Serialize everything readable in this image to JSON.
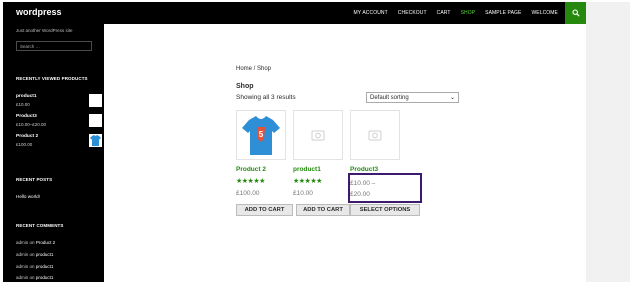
{
  "header": {
    "site_title": "wordpress",
    "nav": [
      "MY ACCOUNT",
      "CHECKOUT",
      "CART",
      "SHOP",
      "SAMPLE PAGE",
      "WELCOME"
    ],
    "active_nav": "SHOP",
    "search_icon": "search-icon",
    "accent_color": "#24890d"
  },
  "sidebar": {
    "tagline": "Just another WordPress site",
    "search_placeholder": "Search …",
    "recently_viewed_title": "RECENTLY VIEWED PRODUCTS",
    "recently_viewed": [
      {
        "name": "product1",
        "price": "£10.00"
      },
      {
        "name": "Product3",
        "price": "£10.00–£20.00"
      },
      {
        "name": "Product 2",
        "price": "£100.00"
      }
    ],
    "recent_posts_title": "RECENT POSTS",
    "recent_posts": [
      "Hello world!"
    ],
    "recent_comments_title": "RECENT COMMENTS",
    "recent_comments": [
      {
        "author": "admin",
        "on": "on",
        "post": "Product 2"
      },
      {
        "author": "admin",
        "on": "on",
        "post": "product1"
      },
      {
        "author": "admin",
        "on": "on",
        "post": "product1"
      },
      {
        "author": "admin",
        "on": "on",
        "post": "product1"
      }
    ]
  },
  "main": {
    "breadcrumb": "Home / Shop",
    "page_title": "Shop",
    "result_count": "Showing all 3 results",
    "sort_selected": "Default sorting",
    "products": [
      {
        "name": "Product 2",
        "rating": 5,
        "stars": "★★★★★",
        "price": "£100.00",
        "button": "ADD TO CART"
      },
      {
        "name": "product1",
        "rating": 5,
        "stars": "★★★★★",
        "price": "£10.00",
        "button": "ADD TO CART"
      },
      {
        "name": "Product3",
        "price_low": "£10.00 –",
        "price_high": "£20.00",
        "button": "SELECT OPTIONS"
      }
    ]
  }
}
